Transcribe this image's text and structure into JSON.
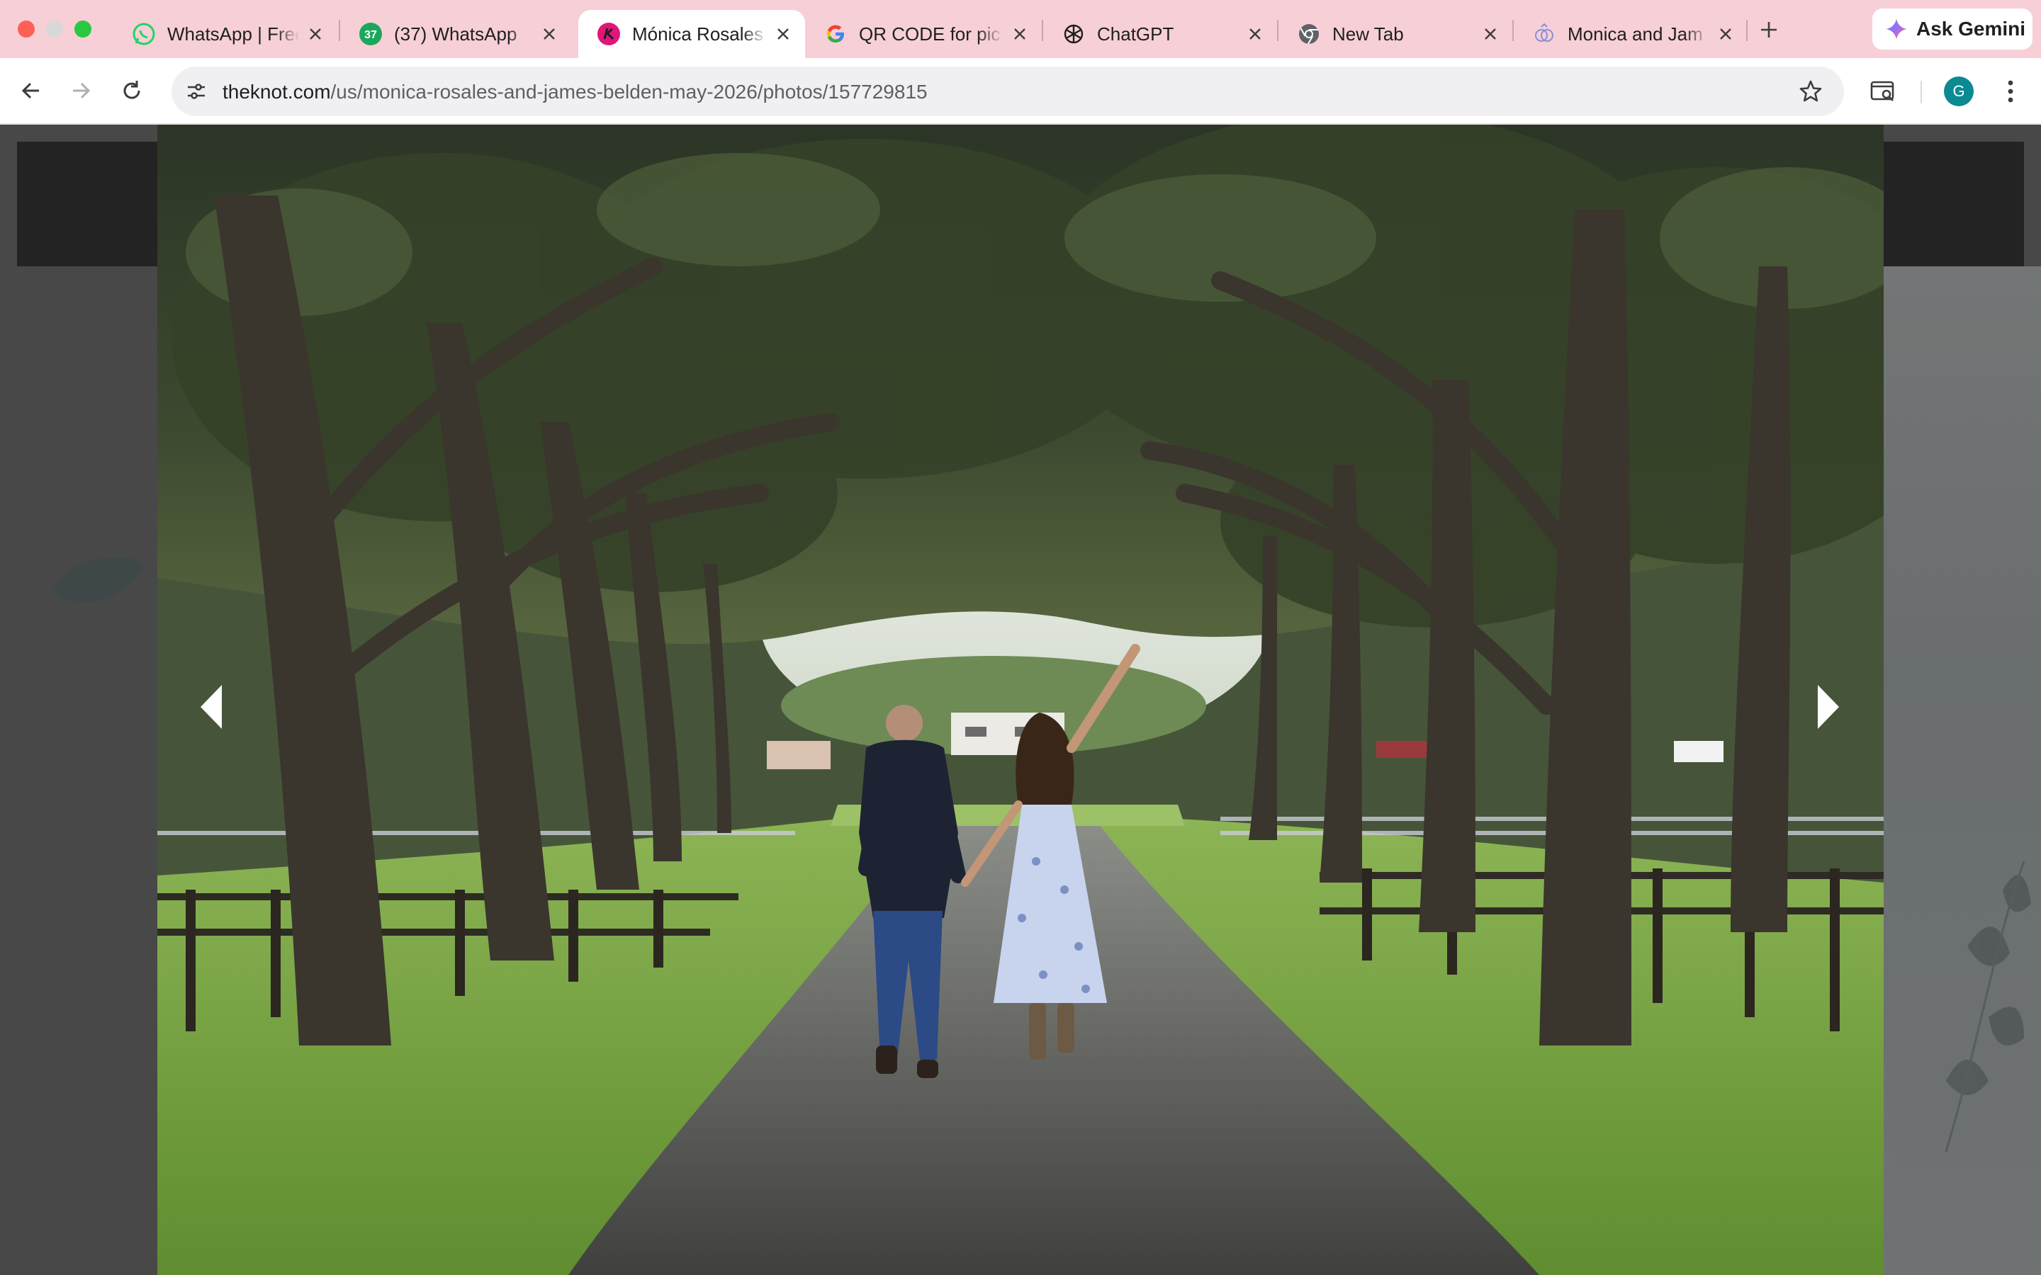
{
  "browser": {
    "tabs": [
      {
        "title": "WhatsApp | Free",
        "icon": "whatsapp-icon",
        "active": false
      },
      {
        "title": "(37) WhatsApp",
        "icon": "whatsapp-badge-icon",
        "badge": "37",
        "active": false
      },
      {
        "title": "Mónica Rosales & ",
        "icon": "theknot-icon",
        "active": true
      },
      {
        "title": "QR CODE for pic",
        "icon": "google-icon",
        "active": false
      },
      {
        "title": "ChatGPT",
        "icon": "chatgpt-icon",
        "active": false
      },
      {
        "title": "New Tab",
        "icon": "chrome-icon",
        "active": false
      },
      {
        "title": "Monica and Jam",
        "icon": "gemini-tab-icon",
        "active": false
      }
    ],
    "gemini_label": "Ask Gemini",
    "url_host": "theknot.com",
    "url_path": "/us/monica-rosales-and-james-belden-may-2026/photos/157729815",
    "profile_initial": "G",
    "colors": {
      "tabbar": "#f6cfd7",
      "accent_profile": "#0b8a92"
    }
  },
  "viewer": {
    "prev_icon": "chevron-left-icon",
    "next_icon": "chevron-right-icon",
    "photo_icon": "engagement-photo"
  }
}
